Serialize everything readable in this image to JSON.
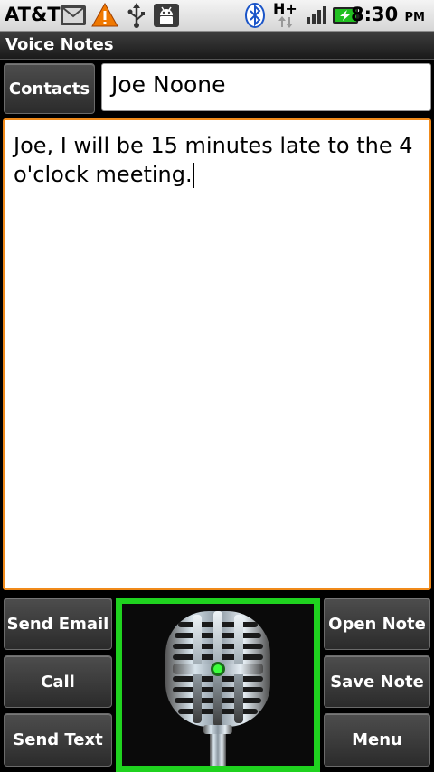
{
  "status_bar": {
    "carrier": "AT&T",
    "time": "8:30",
    "ampm": "PM",
    "network": "H+",
    "icons": [
      "email-icon",
      "warning-icon",
      "usb-icon",
      "android-debug-icon",
      "bluetooth-icon",
      "hplus-data-icon",
      "signal-icon",
      "battery-charging-icon"
    ]
  },
  "title_bar": {
    "title": "Voice Notes"
  },
  "contacts_button": "Contacts",
  "recipient_value": "Joe Noone",
  "note_text": "Joe, I will be 15 minutes late to the 4 o'clock meeting.",
  "left_buttons": [
    "Send Email",
    "Call",
    "Send Text"
  ],
  "right_buttons": [
    "Open Note",
    "Save Note",
    "Menu"
  ],
  "colors": {
    "record_frame": "#1fd21f",
    "note_focus": "#f08a1a",
    "mic_led": "#3cff3c"
  }
}
